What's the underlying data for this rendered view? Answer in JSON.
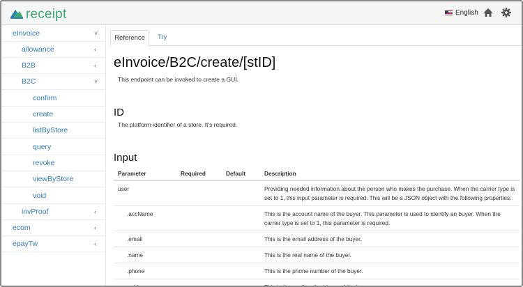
{
  "brand": {
    "name": "receipt",
    "logo_icon": "mountain-logo-icon",
    "color": "#3aa675"
  },
  "header": {
    "language": "English",
    "flag_icon": "us-flag-icon",
    "home_icon": "home-icon",
    "settings_icon": "gear-icon"
  },
  "sidebar": {
    "items": [
      {
        "label": "eInvoice",
        "chevron": "˅"
      },
      {
        "label": "allowance",
        "chevron": "‹"
      },
      {
        "label": "B2B",
        "chevron": "‹"
      },
      {
        "label": "B2C",
        "chevron": "˅"
      },
      {
        "label": "confirm"
      },
      {
        "label": "create"
      },
      {
        "label": "listByStore"
      },
      {
        "label": "query"
      },
      {
        "label": "revoke"
      },
      {
        "label": "viewByStore"
      },
      {
        "label": "void"
      },
      {
        "label": "invProof",
        "chevron": "‹"
      },
      {
        "label": "ecom",
        "chevron": "‹"
      },
      {
        "label": "epayTw",
        "chevron": "‹"
      }
    ]
  },
  "tabs": [
    {
      "label": "Reference",
      "active": true
    },
    {
      "label": "Try",
      "active": false
    }
  ],
  "main": {
    "title": "eInvoice/B2C/create/[stID]",
    "description": "This endpoint can be invoked to create a GUI.",
    "id_heading": "ID",
    "id_description": "The platform identifier of a store. It's required.",
    "input_heading": "Input",
    "table": {
      "headers": [
        "Parameter",
        "Required",
        "Default",
        "Description"
      ],
      "rows": [
        {
          "param": "user",
          "required": "",
          "default": "",
          "desc": "Providing needed information about the person who makes the purchase. When the carrier type is set to 1, this input parameter is required. This will be a JSON object with the following properties:"
        },
        {
          "param": ".accName",
          "required": "",
          "default": "",
          "desc": "This is the account name of the buyer. This parameter is used to identify an buyer. When the carrier type is set to 1, this parameter is required."
        },
        {
          "param": ".email",
          "required": "",
          "default": "",
          "desc": "This is the email address of the buyer."
        },
        {
          "param": ".name",
          "required": "",
          "default": "",
          "desc": "This is the real name of the buyer."
        },
        {
          "param": ".phone",
          "required": "",
          "default": "",
          "desc": "This is the phone number of the buyer."
        },
        {
          "param": ".addr",
          "required": "",
          "default": "",
          "desc": "This is the snail mail address of the buyer."
        }
      ]
    }
  }
}
